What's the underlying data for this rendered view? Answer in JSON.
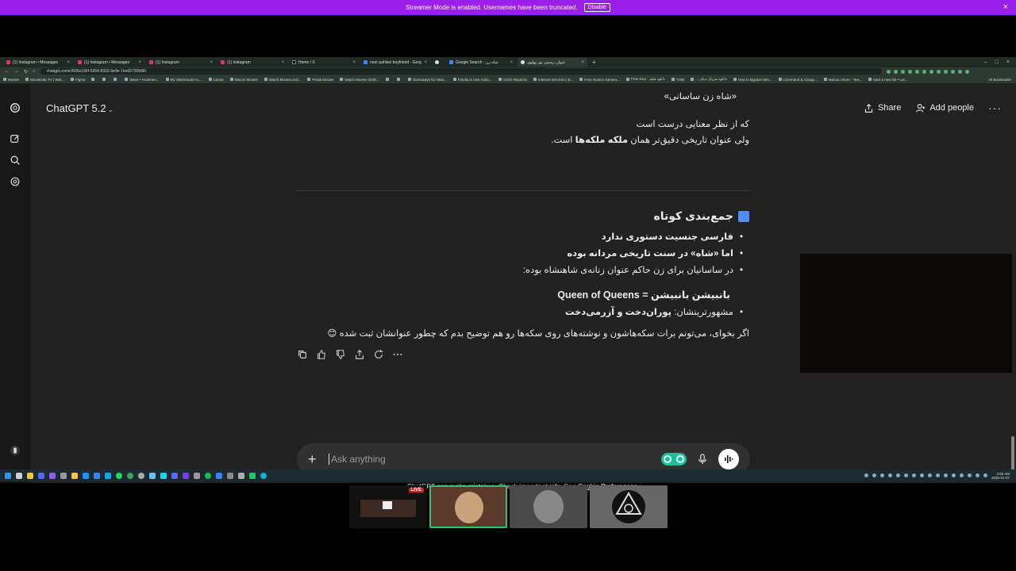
{
  "streamer_banner": {
    "message": "Streamer Mode is enabled. Usernames have been truncated.",
    "button": "Disable",
    "close": "×"
  },
  "browser": {
    "tabs": [
      {
        "label": "(1) Instagram • Messages"
      },
      {
        "label": "(1) Instagram • Messages"
      },
      {
        "label": "(1) Instagram"
      },
      {
        "label": "(1) Instagram"
      },
      {
        "label": "Home / X"
      },
      {
        "label": "noor pahlavi boyfriend - Goog"
      },
      {
        "label": ""
      },
      {
        "label": "Google Search - شاه زن"
      },
      {
        "label": "عنوان رسمی نور پهلوی"
      }
    ],
    "new_tab": "+",
    "url": "chatgpt.com/c/695e166f-5264-8332-9e9e-7ee65730fd96",
    "bookmarks": [
      "Movies",
      "MovieGeb TV | Wat...",
      "Figma",
      "",
      "",
      "",
      "Wave • Hostmen...",
      "My SiteGround Ac...",
      "Canva",
      "Bitcoin Movies",
      "Watch Movies and...",
      "Freak Movies",
      "Watch Movies Onlin...",
      "",
      "",
      "Giveaways for Stea...",
      "Fotolia is now Adob...",
      "GOGI Repacks",
      "Internet Services | B...",
      "Free Invoice Genera...",
      "Free Guy... دانلود فیلم",
      "THW",
      "... دانلود سریال دنیای",
      "How to Bypass Win...",
      "Command & Conqu...",
      "Mamou Store - Tea...",
      "Start a new list • Let..."
    ],
    "all_bookmarks": "All Bookmarks"
  },
  "chatgpt": {
    "model_title": "ChatGPT 5.2",
    "share": "Share",
    "add_people": "Add people",
    "top_line": "«شاه زن ساسانی»",
    "line2": "که از نظر معنایی درست است",
    "line3_a": "ولی عنوان تاریخی دقیق‌تر همان ",
    "line3_b": "ملکه ملکه‌ها",
    "line3_c": " است.",
    "summary_heading": "جمع‌بندی کوتاه",
    "bullets": [
      "فارسی جنسیت دستوری ندارد",
      "اما «شاه» در سنت تاریخی مردانه بوده",
      "در ساسانیان برای زن حاکم عنوان زنانه‌ی شاهنشاه بوده:"
    ],
    "subheading": "بانبیشن بانبیشن = Queen of Queens",
    "bullet_famous_a": "مشهورترینشان: ",
    "bullet_famous_b": "پوران‌دخت و آزرمی‌دخت",
    "closing": "اگر بخوای، می‌تونم برات سکه‌هاشون و نوشته‌های روی سکه‌ها رو هم توضیح بدم که چطور عنوانشان ثبت شده 😊",
    "composer_placeholder": "Ask anything",
    "disclaimer": "ChatGPT can make mistakes. Check important info. See ",
    "cookie_link": "Cookie Preferences",
    "cookie_end": "."
  },
  "clock": {
    "time": "2:55 AM",
    "date": "2026-01-07"
  },
  "thumbnails": {
    "live_badge": "LIVE"
  },
  "colors": {
    "streamer": "#9b1fe8",
    "accent_blue": "#4f8ef7",
    "grammarly": "#15c39a"
  }
}
